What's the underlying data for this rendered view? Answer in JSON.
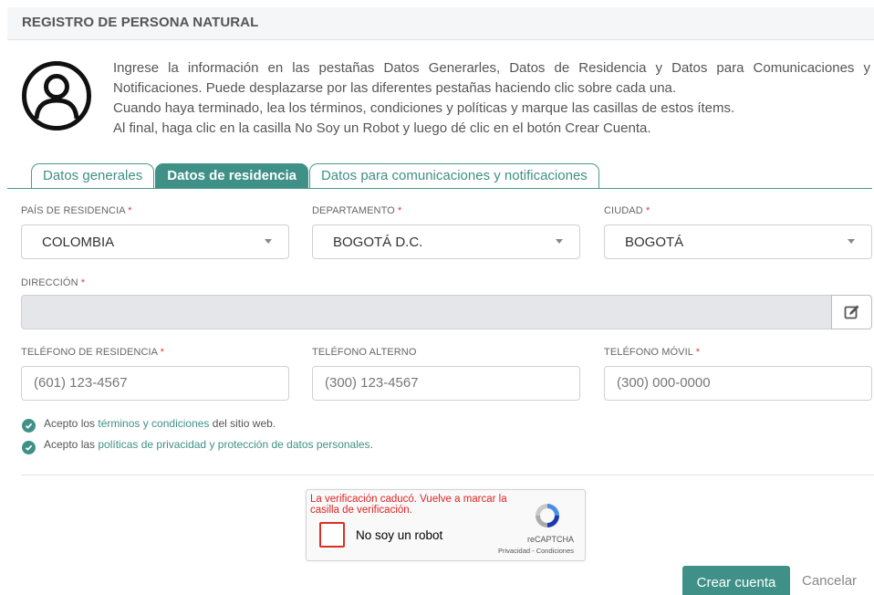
{
  "header": {
    "title": "REGISTRO DE PERSONA NATURAL"
  },
  "intro": {
    "line1": "Ingrese la información en las pestañas Datos Generarles, Datos de Residencia y Datos para Comunicaciones y Notificaciones. Puede desplazarse por las diferentes pestañas haciendo clic sobre cada una.",
    "line2": "Cuando haya terminado, lea los términos, condiciones y políticas y marque las casillas de estos ítems.",
    "line3": "Al final, haga clic en la casilla No Soy un Robot y luego dé clic en el botón Crear Cuenta."
  },
  "tabs": [
    {
      "label": "Datos generales",
      "active": false
    },
    {
      "label": "Datos de residencia",
      "active": true
    },
    {
      "label": "Datos para comunicaciones y notificaciones",
      "active": false
    }
  ],
  "form": {
    "pais": {
      "label": "PAÍS DE RESIDENCIA",
      "required": "*",
      "value": "COLOMBIA"
    },
    "departamento": {
      "label": "DEPARTAMENTO",
      "required": "*",
      "value": "BOGOTÁ D.C."
    },
    "ciudad": {
      "label": "CIUDAD",
      "required": "*",
      "value": "BOGOTÁ"
    },
    "direccion": {
      "label": "DIRECCIÓN",
      "required": "*",
      "value": ""
    },
    "tel_residencia": {
      "label": "TELÉFONO DE RESIDENCIA",
      "required": "*",
      "placeholder": "(601) 123-4567"
    },
    "tel_alterno": {
      "label": "TELÉFONO ALTERNO",
      "placeholder": "(300) 123-4567"
    },
    "tel_movil": {
      "label": "TELÉFONO MÓVIL",
      "required": "*",
      "placeholder": "(300) 000-0000"
    }
  },
  "checks": {
    "terms": {
      "prefix": "Acepto los ",
      "link": "términos y condiciones",
      "suffix": " del sitio web.",
      "checked": true
    },
    "privacy": {
      "prefix": "Acepto las ",
      "link": "políticas de privacidad y protección de datos personales",
      "suffix": ".",
      "checked": true
    }
  },
  "captcha": {
    "error": "La verificación caducó. Vuelve a marcar la casilla de verificación.",
    "label": "No soy un robot",
    "brand": "reCAPTCHA",
    "privacy": "Privacidad",
    "separator": " - ",
    "terms": "Condiciones"
  },
  "buttons": {
    "create": "Crear cuenta",
    "cancel": "Cancelar"
  },
  "colors": {
    "accent": "#3f9188",
    "required": "#e53935",
    "error": "#e02424"
  }
}
